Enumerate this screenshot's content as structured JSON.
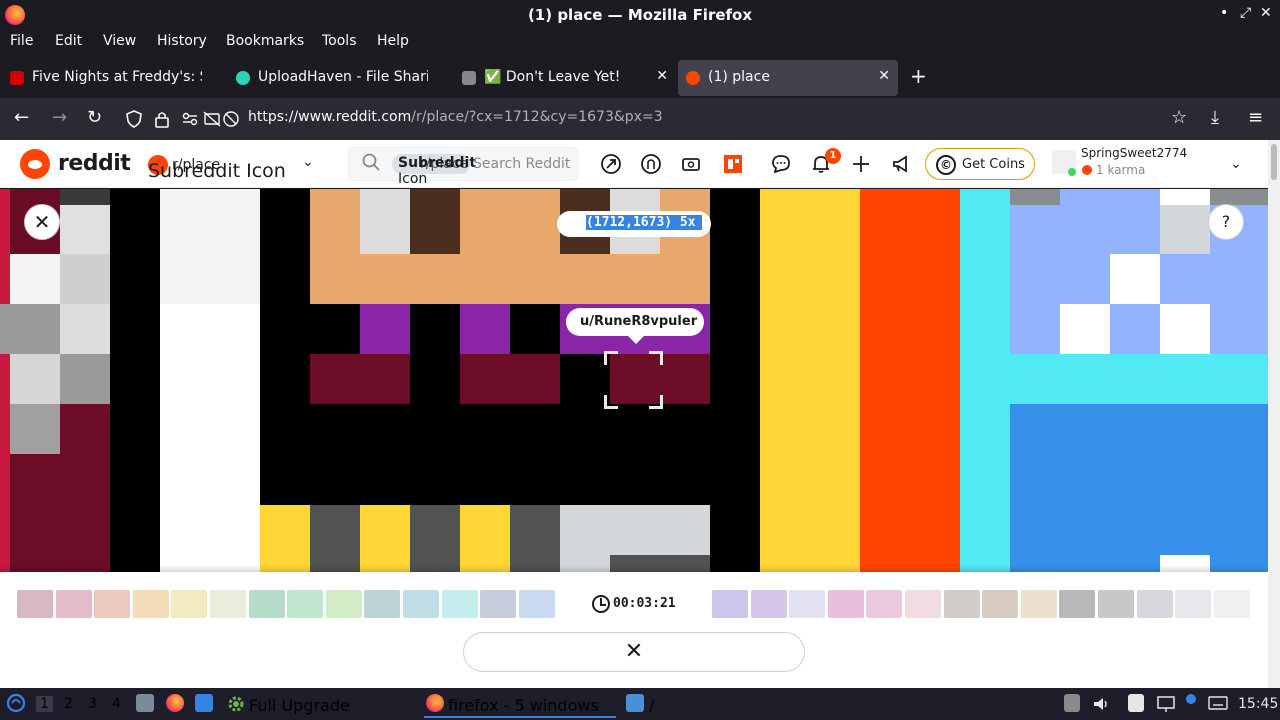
{
  "window": {
    "title": "(1) place — Mozilla Firefox",
    "controls": [
      "•",
      "⤢",
      "✕"
    ]
  },
  "menu": [
    "File",
    "Edit",
    "View",
    "History",
    "Bookmarks",
    "Tools",
    "Help"
  ],
  "tabs": [
    {
      "label": "Five Nights at Freddy's: S",
      "active": false,
      "icon_color": "#d40000"
    },
    {
      "label": "UploadHaven - File Sharin",
      "active": false,
      "icon_color": "#2fd3b5"
    },
    {
      "label": "✅ Don't Leave Yet!",
      "active": false,
      "icon_color": "#888888"
    },
    {
      "label": "(1) place",
      "active": true,
      "icon_color": "#ff4500"
    }
  ],
  "new_tab_symbol": "+",
  "tab_close_symbol": "✕",
  "nav": {
    "back": "←",
    "forward": "→",
    "reload": "↻",
    "url_domain": "https://www.reddit.com",
    "url_path": "/r/place/?cx=1712&cy=1673&px=3",
    "bookmark": "☆",
    "download": "⤓",
    "menu": "≡"
  },
  "reddit": {
    "wordmark": "reddit",
    "subreddit_label": "r/place",
    "subreddit_alt": "Subreddit Icon",
    "search_chip": "Subreddit",
    "search_chip_sub": "r/place",
    "search_chip_icon": "Icon",
    "search_placeholder": "Search Reddit",
    "notification_count": "1",
    "get_coins": "Get Coins",
    "coins_symbol": "©",
    "username": "SpringSweet2774",
    "karma": "1 karma",
    "dropdown": "⌄"
  },
  "canvas": {
    "coordinates": "(1712,1673) 5x",
    "pixel_owner": "u/RuneR8vpuler",
    "close_symbol": "✕",
    "help_symbol": "?"
  },
  "palette": {
    "colors": [
      "#d6b8c0",
      "#e2bccb",
      "#ecc9bd",
      "#f2ddb8",
      "#f2eac0",
      "#ececdc",
      "#b5dcc8",
      "#bfe6cc",
      "#d3ecc8",
      "#bcd4d4",
      "#bfdee6",
      "#c4ecec",
      "#c6cede",
      "#c8dbf0",
      "#cdc6ec",
      "#d6c6ec",
      "#e4e2f2",
      "#e9c0dc",
      "#ecc8de",
      "#f2dce2",
      "#d0ccc8",
      "#d8cdc0",
      "#ece0d0",
      "#b8b8b8",
      "#c8c8c8",
      "#d6d6dc",
      "#e8e8ec",
      "#f0f0f2"
    ],
    "timer": "00:03:21",
    "cancel_symbol": "✕"
  },
  "taskbar": {
    "workspaces": [
      "1",
      "2",
      "3",
      "4"
    ],
    "active_workspace": "1",
    "update_label": "Full Upgrade",
    "task_label": "firefox - 5 windows",
    "folder_label": "/",
    "clock": "15:45"
  }
}
